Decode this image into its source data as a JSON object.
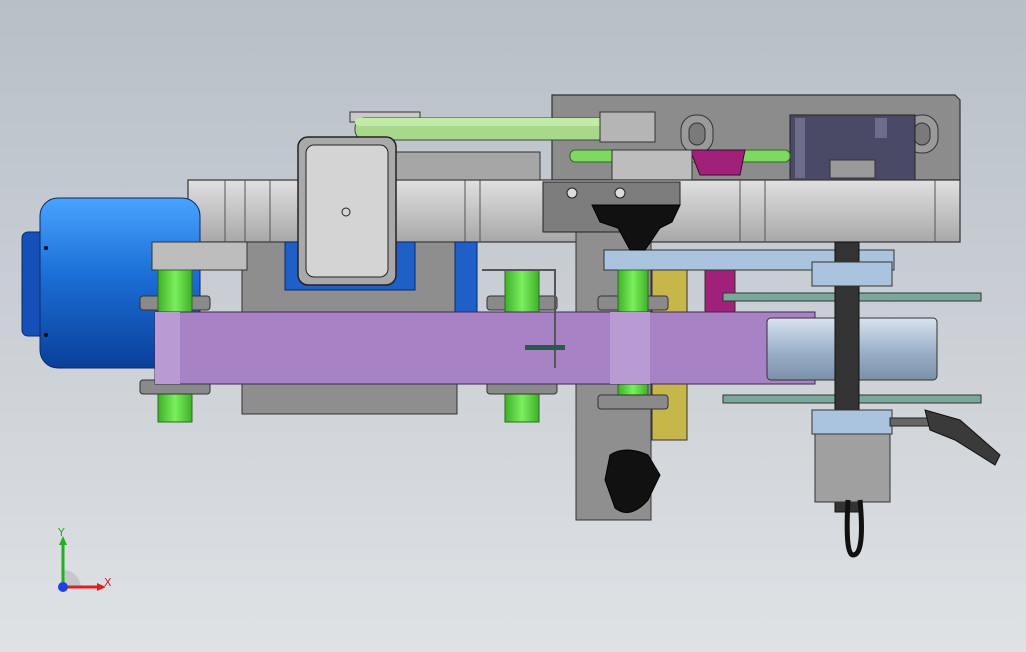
{
  "viewport": {
    "background_top": "#b7bfc7",
    "background_bottom": "#dfe2e5"
  },
  "model": {
    "colors": {
      "motor": "#1b6fd6",
      "frame_gray": "#c8c8c8",
      "dark_plate": "#8e8e8e",
      "belt_purple": "#a782c4",
      "green_part": "#5fd446",
      "light_green": "#9fd98c",
      "light_blue": "#aac4e0",
      "yellow_part": "#d4c24a",
      "magenta_part": "#a0207a",
      "knob_black": "#111111"
    }
  },
  "triad": {
    "x_label": "X",
    "y_label": "Y",
    "x_color": "#e02020",
    "y_color": "#20b020",
    "z_color": "#2040e0"
  }
}
